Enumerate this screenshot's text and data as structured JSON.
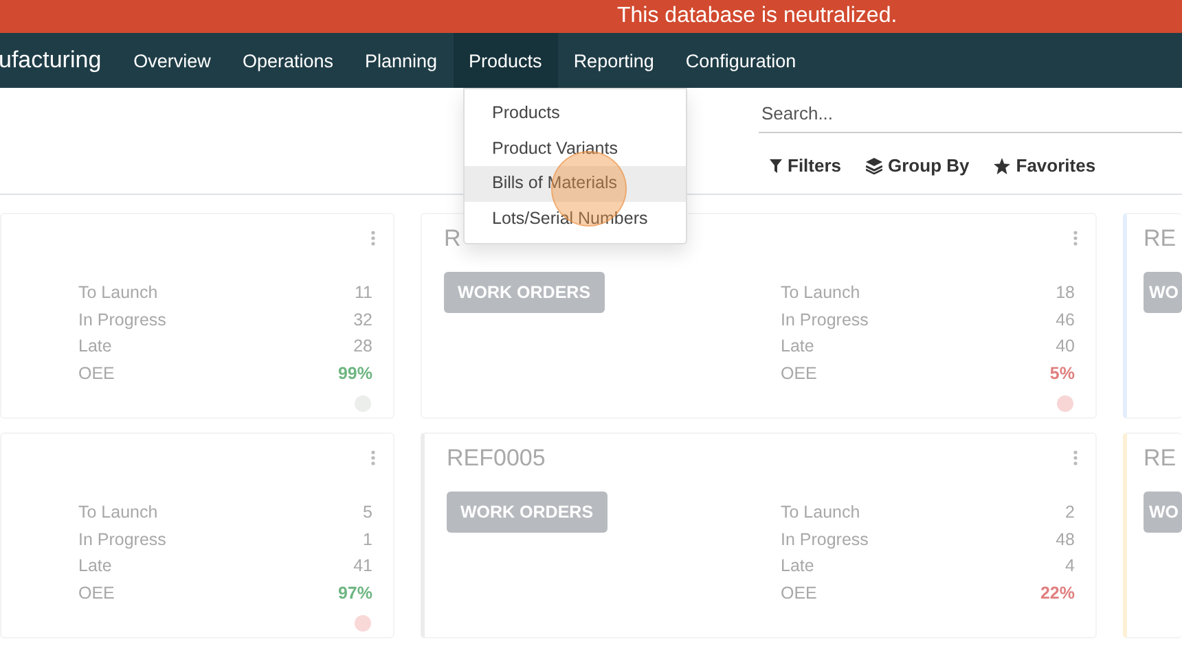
{
  "banner": {
    "text": "This database is neutralized."
  },
  "navbar": {
    "brand": "ufacturing",
    "menus": [
      {
        "label": "Overview",
        "selected": false
      },
      {
        "label": "Operations",
        "selected": false
      },
      {
        "label": "Planning",
        "selected": false
      },
      {
        "label": "Products",
        "selected": true
      },
      {
        "label": "Reporting",
        "selected": false
      },
      {
        "label": "Configuration",
        "selected": false
      }
    ]
  },
  "dropdown": {
    "items": [
      {
        "label": "Products",
        "selected": false
      },
      {
        "label": "Product Variants",
        "selected": false
      },
      {
        "label": "Bills of Materials",
        "selected": true
      },
      {
        "label": "Lots/Serial Numbers",
        "selected": false
      }
    ]
  },
  "search": {
    "placeholder": "Search..."
  },
  "filters": [
    {
      "label": "Filters",
      "kind": "filter"
    },
    {
      "label": "Group By",
      "kind": "group"
    },
    {
      "label": "Favorites",
      "kind": "star"
    }
  ],
  "cards": [
    {
      "stats": [
        {
          "label": "To Launch",
          "value": "11"
        },
        {
          "label": "In Progress",
          "value": "32"
        },
        {
          "label": "Late",
          "value": "28"
        },
        {
          "label": "OEE",
          "value": "99%",
          "color": "#6db581"
        }
      ],
      "status_dot": {
        "color": "#eceeec"
      }
    },
    {
      "title": "R",
      "button": "WORK ORDERS",
      "stats": [
        {
          "label": "To Launch",
          "value": "18"
        },
        {
          "label": "In Progress",
          "value": "46"
        },
        {
          "label": "Late",
          "value": "40"
        },
        {
          "label": "OEE",
          "value": "5%",
          "color": "#e07f7f"
        }
      ],
      "status_dot": {
        "color": "#f8d6d6"
      }
    },
    {
      "title": "RE",
      "button": "WO",
      "color": "#e3eefa"
    },
    {
      "stats": [
        {
          "label": "To Launch",
          "value": "5"
        },
        {
          "label": "In Progress",
          "value": "1"
        },
        {
          "label": "Late",
          "value": "41"
        },
        {
          "label": "OEE",
          "value": "97%",
          "color": "#6db581"
        }
      ],
      "status_dot": {
        "color": "#f9d8d8"
      }
    },
    {
      "title": "REF0005",
      "button": "WORK ORDERS",
      "color": "#ececec",
      "stats": [
        {
          "label": "To Launch",
          "value": "2"
        },
        {
          "label": "In Progress",
          "value": "48"
        },
        {
          "label": "Late",
          "value": "4"
        },
        {
          "label": "OEE",
          "value": "22%",
          "color": "#e07f7f"
        }
      ]
    },
    {
      "title": "RE",
      "button": "WO",
      "color": "#fcf1d6"
    }
  ]
}
